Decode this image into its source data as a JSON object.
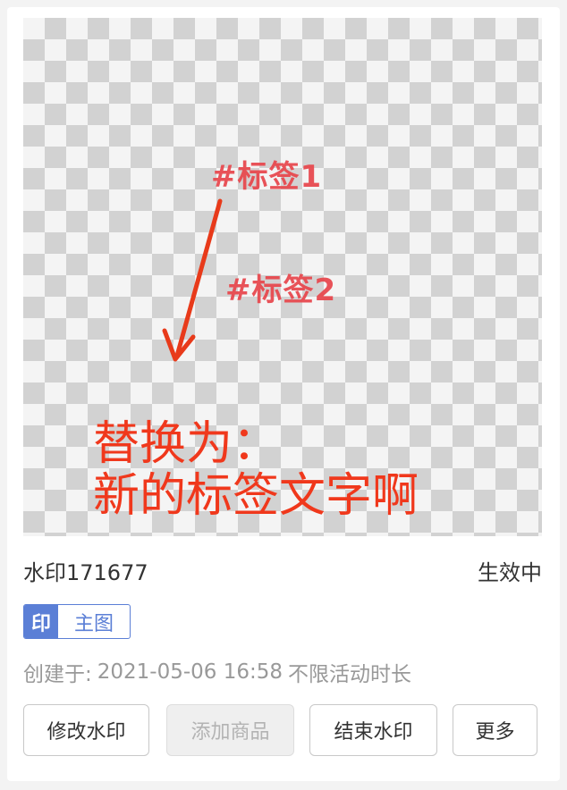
{
  "preview": {
    "tag1": "#标签1",
    "tag2": "#标签2",
    "replace_line1": "替换为：",
    "replace_line2": "新的标签文字啊"
  },
  "watermark": {
    "name": "水印171677",
    "status": "生效中",
    "badge_icon": "印",
    "badge_label": "主图",
    "created_label": "创建于:",
    "created_time": "2021-05-06 16:58",
    "duration": "不限活动时长"
  },
  "actions": {
    "edit": "修改水印",
    "add_product": "添加商品",
    "end": "结束水印",
    "more": "更多"
  },
  "colors": {
    "accent": "#5b7fd6",
    "preview_text": "#f0381c",
    "tag_text": "#e8454b",
    "muted_text": "#999999"
  }
}
